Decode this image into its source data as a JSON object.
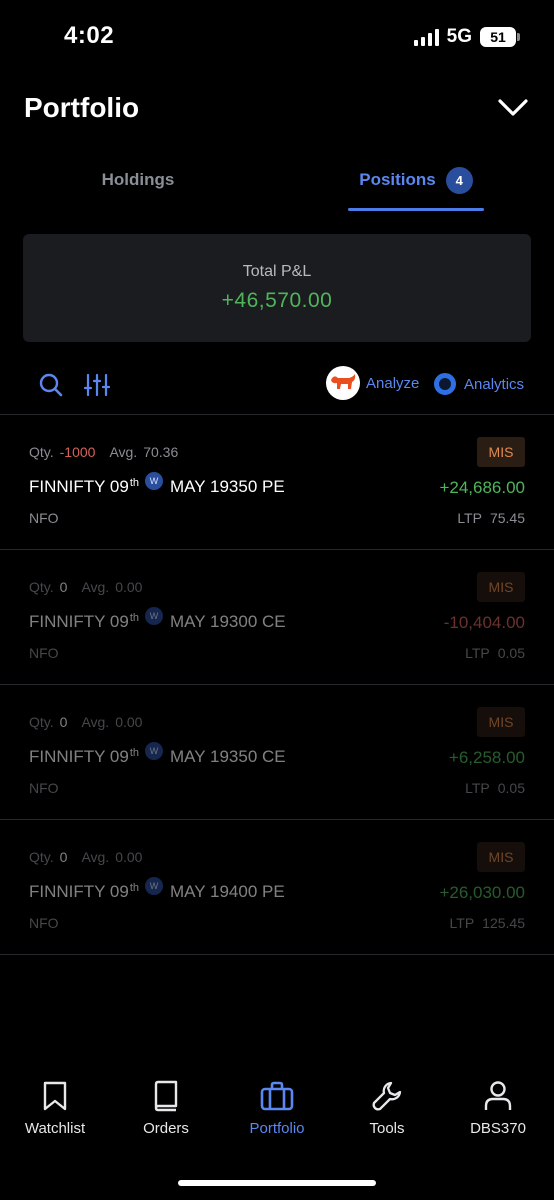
{
  "status_bar": {
    "time": "4:02",
    "network": "5G",
    "battery": "51"
  },
  "header": {
    "title": "Portfolio",
    "collapse_icon": "chevron-down-icon"
  },
  "tabs": {
    "holdings_label": "Holdings",
    "positions_label": "Positions",
    "positions_count": "4",
    "active": "Positions"
  },
  "summary": {
    "label": "Total P&L",
    "value": "+46,570.00"
  },
  "toolbar": {
    "search_icon": "search-icon",
    "filter_icon": "filter-sliders-icon",
    "analyze_label": "Analyze",
    "analytics_label": "Analytics"
  },
  "positions": [
    {
      "qty_label": "Qty.",
      "qty": "-1000",
      "avg_label": "Avg.",
      "avg": "70.36",
      "product": "MIS",
      "symbol": "FINNIFTY 09",
      "date_suffix": "th",
      "weekly_badge": "W",
      "contract": "MAY 19350 PE",
      "pnl": "+24,686.00",
      "exchange": "NFO",
      "ltp_label": "LTP",
      "ltp": "75.45",
      "status": "open"
    },
    {
      "qty_label": "Qty.",
      "qty": "0",
      "avg_label": "Avg.",
      "avg": "0.00",
      "product": "MIS",
      "symbol": "FINNIFTY 09",
      "date_suffix": "th",
      "weekly_badge": "W",
      "contract": "MAY 19300 CE",
      "pnl": "-10,404.00",
      "exchange": "NFO",
      "ltp_label": "LTP",
      "ltp": "0.05",
      "status": "closed"
    },
    {
      "qty_label": "Qty.",
      "qty": "0",
      "avg_label": "Avg.",
      "avg": "0.00",
      "product": "MIS",
      "symbol": "FINNIFTY 09",
      "date_suffix": "th",
      "weekly_badge": "W",
      "contract": "MAY 19350 CE",
      "pnl": "+6,258.00",
      "exchange": "NFO",
      "ltp_label": "LTP",
      "ltp": "0.05",
      "status": "closed"
    },
    {
      "qty_label": "Qty.",
      "qty": "0",
      "avg_label": "Avg.",
      "avg": "0.00",
      "product": "MIS",
      "symbol": "FINNIFTY 09",
      "date_suffix": "th",
      "weekly_badge": "W",
      "contract": "MAY 19400 PE",
      "pnl": "+26,030.00",
      "exchange": "NFO",
      "ltp_label": "LTP",
      "ltp": "125.45",
      "status": "closed"
    }
  ],
  "bottom_nav": [
    {
      "label": "Watchlist",
      "icon": "bookmark-icon"
    },
    {
      "label": "Orders",
      "icon": "book-icon"
    },
    {
      "label": "Portfolio",
      "icon": "briefcase-icon",
      "active": true
    },
    {
      "label": "Tools",
      "icon": "wrench-icon"
    },
    {
      "label": "DBS370",
      "icon": "user-icon"
    }
  ],
  "colors": {
    "accent": "#5b87f0",
    "profit": "#4fb55a",
    "loss": "#d4625b",
    "product_badge": "#e08a4e"
  }
}
